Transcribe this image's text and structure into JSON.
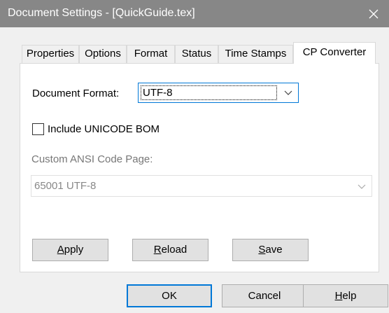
{
  "window": {
    "title": "Document Settings - [QuickGuide.tex]"
  },
  "tabs": [
    "Properties",
    "Options",
    "Format",
    "Status",
    "Time Stamps",
    "CP Converter"
  ],
  "active_tab": "CP Converter",
  "format": {
    "label": "Document Format:",
    "value": "UTF-8"
  },
  "bom": {
    "label": "Include UNICODE BOM",
    "checked": false
  },
  "ansi": {
    "label": "Custom ANSI Code Page:",
    "value": "65001 UTF-8"
  },
  "panel_buttons": {
    "apply": {
      "mnemonic": "A",
      "rest": "pply"
    },
    "reload": {
      "mnemonic": "R",
      "rest": "eload"
    },
    "save": {
      "mnemonic": "S",
      "rest": "ave"
    }
  },
  "dialog_buttons": {
    "ok": "OK",
    "cancel": "Cancel",
    "help": {
      "mnemonic": "H",
      "rest": "elp"
    }
  }
}
